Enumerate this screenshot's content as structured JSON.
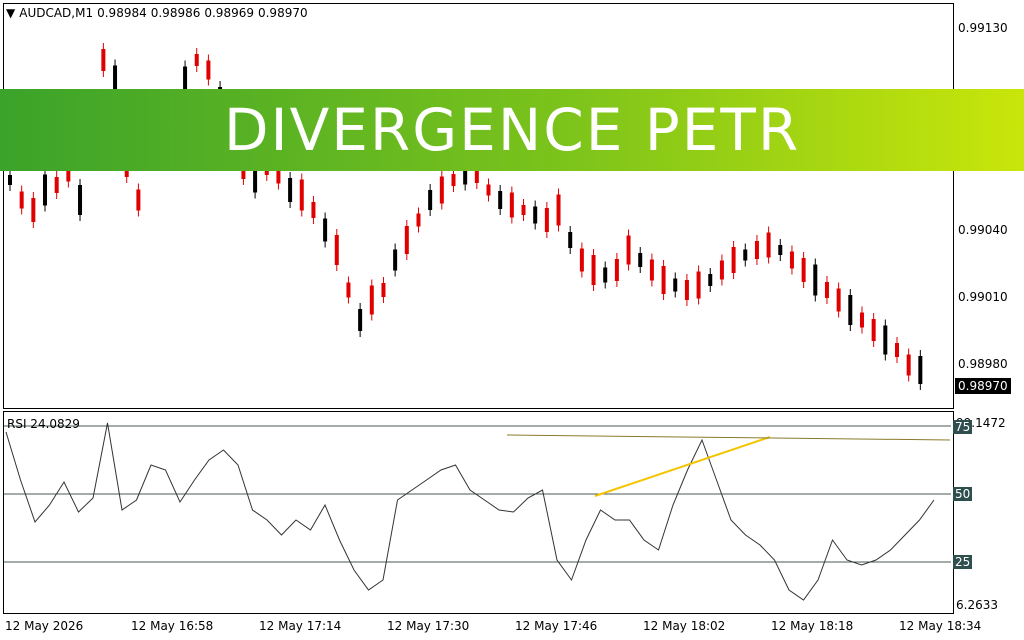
{
  "symbol_header": {
    "symbol": "AUDCAD,M1",
    "open": "0.98984",
    "high": "0.98986",
    "low": "0.98969",
    "close": "0.98970"
  },
  "price_axis": [
    "0.99130",
    "0.99040",
    "0.99010",
    "0.98980"
  ],
  "current_price": "0.98970",
  "rsi": {
    "label": "RSI 24.0829",
    "max_label": "99.1472",
    "min_label": "6.2633",
    "levels": [
      "75",
      "50",
      "25"
    ]
  },
  "time_axis": [
    "12 May 2026",
    "12 May 16:58",
    "12 May 17:14",
    "12 May 17:30",
    "12 May 17:46",
    "12 May 18:02",
    "12 May 18:18",
    "12 May 18:34"
  ],
  "banner_text": "DIVERGENCE PETR",
  "colors": {
    "bull": "#000000",
    "bear": "#e00000",
    "divergence": "#f5c400",
    "banner_start": "#3ba32a",
    "banner_end": "#c9e60a"
  }
}
